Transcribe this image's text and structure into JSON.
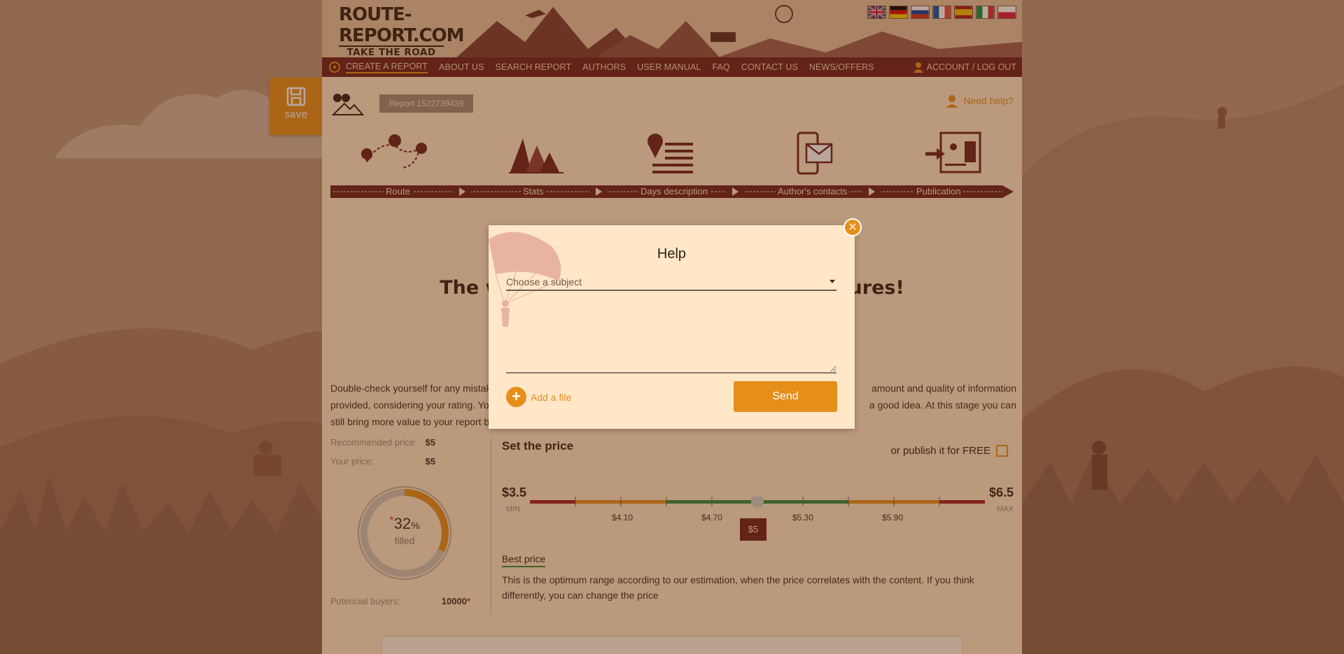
{
  "header": {
    "logo_main": "ROUTE-REPORT.COM",
    "logo_sub": "TAKE THE ROAD",
    "flags": [
      "gb-flag",
      "de-flag",
      "ru-flag",
      "fr-flag",
      "es-flag",
      "it-flag",
      "pl-flag"
    ],
    "account": "ACCOUNT / LOG OUT"
  },
  "nav": {
    "items": [
      "CREATE A REPORT",
      "ABOUT US",
      "SEARCH REPORT",
      "AUTHORS",
      "USER MANUAL",
      "FAQ",
      "CONTACT US",
      "NEWS/OFFERS"
    ]
  },
  "save_label": "save",
  "report_id": "Report 1522739439",
  "need_help": "Need help?",
  "steps": [
    "Route",
    "Stats",
    "Days description",
    "Author's contacts",
    "Publication"
  ],
  "main": {
    "title_left": "The w",
    "title_right": "ures!",
    "desc_line1_left": "Double-check yourself for any mistak",
    "desc_line1_right": "amount and quality of information",
    "desc_line2_left": "provided, considering your rating. You",
    "desc_line2_right": "a good idea. At this stage you can",
    "desc_line3_left": "still bring more value to your report b"
  },
  "pricing": {
    "recommended_label": "Recommended price:",
    "recommended_value": "$5",
    "your_label": "Your price:",
    "your_value": "$5",
    "filled_percent": "32",
    "filled_percent_fraction": 0.32,
    "percent_sign": "%",
    "asterisk": "*",
    "filled_label": "filled",
    "buyers_label": "Potencial buyers:",
    "buyers_value": "10000",
    "set_price_title": "Set the price",
    "free_label": "or publish it for FREE",
    "min_value": "$3.5",
    "min_caption": "MIN",
    "max_value": "$6.5",
    "max_caption": "MAX",
    "ticks": [
      "$4.10",
      "$4.70",
      "$5.30",
      "$5.90"
    ],
    "current": "$5",
    "best_price_title": "Best price",
    "best_price_desc": "This is the optimum range according to our estimation, when the price correlates with the content. If you think differently, you can change the price"
  },
  "modal": {
    "title": "Help",
    "subject_placeholder": "Choose a subject",
    "add_file": "Add a file",
    "send": "Send"
  },
  "colors": {
    "accent": "#e58e1a",
    "maroon": "#6a1c1c",
    "panel": "#ffe7c8"
  }
}
